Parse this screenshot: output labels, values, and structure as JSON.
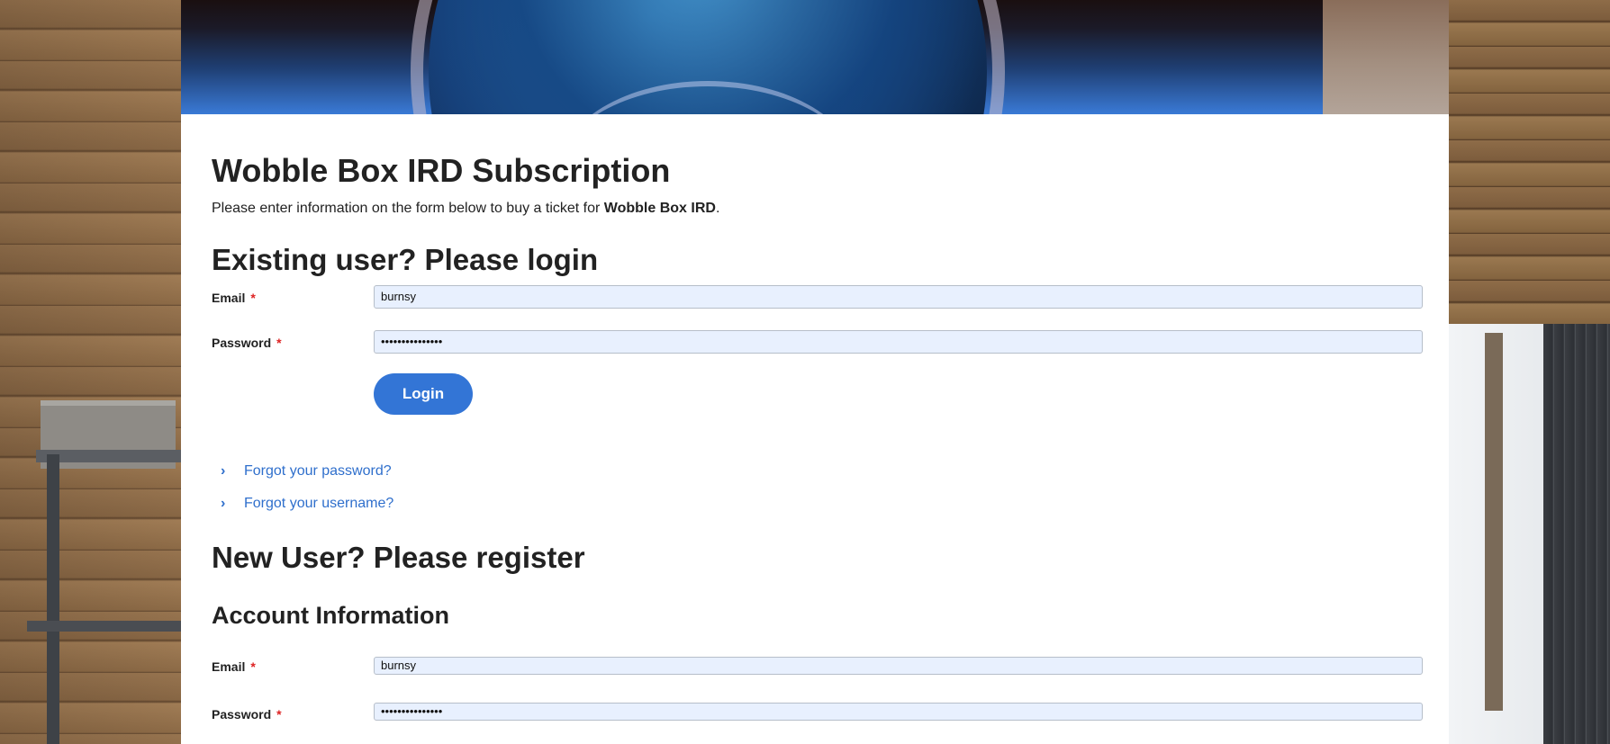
{
  "page": {
    "title": "Wobble Box IRD Subscription",
    "intro_prefix": "Please enter information on the form below to buy a ticket for ",
    "intro_event": "Wobble Box IRD",
    "intro_suffix": "."
  },
  "login": {
    "heading": "Existing user? Please login",
    "email_label": "Email",
    "email_value": "burnsy",
    "password_label": "Password",
    "password_value": "•••••••••••••••",
    "required_mark": "*",
    "submit_label": "Login",
    "forgot_password": "Forgot your password?",
    "forgot_username": "Forgot your username?"
  },
  "register": {
    "heading": "New User? Please register",
    "section_heading": "Account Information",
    "email_label": "Email",
    "email_value": "burnsy",
    "password_label": "Password",
    "password_value": "•••••••••••••••",
    "required_mark": "*"
  },
  "icons": {
    "chevron": "chevron-right-icon"
  },
  "colors": {
    "accent": "#3375d6",
    "link": "#2f6fcc",
    "required": "#dd2222",
    "field_bg": "#e8f0fe"
  }
}
